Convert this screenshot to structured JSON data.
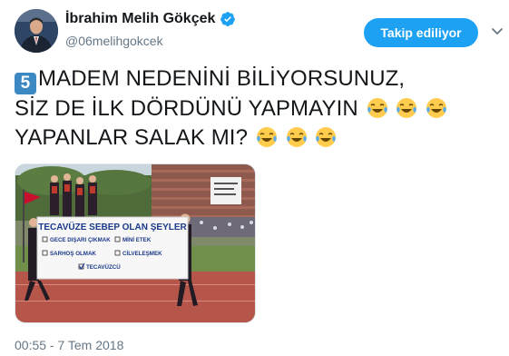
{
  "user": {
    "display_name": "İbrahim Melih Gökçek",
    "handle": "@06melihgokcek",
    "verified": true
  },
  "follow_button": {
    "label": "Takip ediliyor"
  },
  "tweet": {
    "keycap": "5",
    "line1": "MADEM NEDENİNİ BİLİYORSUNUZ,",
    "line2": "SİZ DE İLK DÖRDÜNÜ YAPMAYIN",
    "line3": "YAPANLAR SALAK MI?"
  },
  "media": {
    "banner_title": "TECAVÜZE SEBEP OLAN ŞEYLER",
    "items_left": [
      "GECE DIŞARI ÇIKMAK",
      "SARHOŞ OLMAK"
    ],
    "items_right": [
      "MİNİ ETEK",
      "CİLVELEŞMEK"
    ],
    "item_checked": "TECAVÜZCÜ"
  },
  "timestamp": "00:55 - 7 Tem 2018",
  "colors": {
    "accent": "#1da1f2",
    "muted": "#657786",
    "text": "#14171a"
  }
}
